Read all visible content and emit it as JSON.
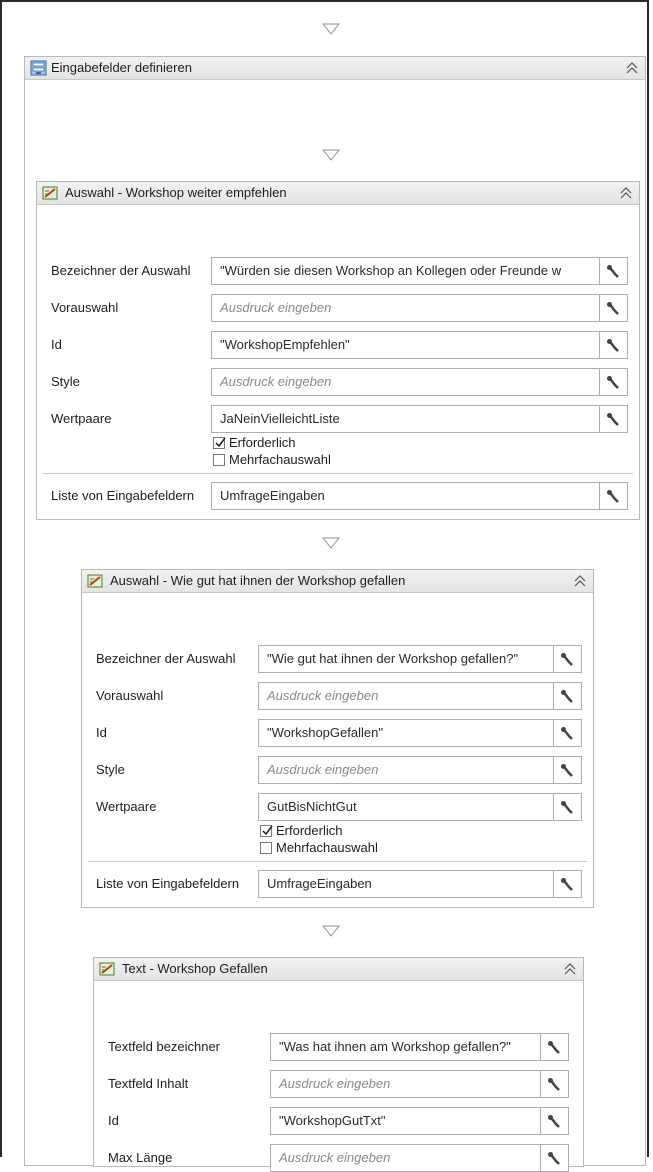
{
  "outer": {
    "title": "Eingabefelder definieren"
  },
  "panels": [
    {
      "title": "Auswahl - Workshop weiter empfehlen",
      "fields": [
        {
          "label": "Bezeichner der Auswahl",
          "value": "\"Würden sie diesen Workshop an Kollegen oder Freunde w",
          "placeholder": ""
        },
        {
          "label": "Vorauswahl",
          "value": "",
          "placeholder": "Ausdruck eingeben"
        },
        {
          "label": "Id",
          "value": "\"WorkshopEmpfehlen\"",
          "placeholder": ""
        },
        {
          "label": "Style",
          "value": "",
          "placeholder": "Ausdruck eingeben"
        },
        {
          "label": "Wertpaare",
          "value": "JaNeinVielleichtListe",
          "placeholder": ""
        }
      ],
      "checkboxes": [
        {
          "label": "Erforderlich",
          "checked": true
        },
        {
          "label": "Mehrfachauswahl",
          "checked": false
        }
      ],
      "list_field": {
        "label": "Liste von Eingabefeldern",
        "value": "UmfrageEingaben"
      }
    },
    {
      "title": "Auswahl - Wie gut hat ihnen der Workshop gefallen",
      "fields": [
        {
          "label": "Bezeichner der Auswahl",
          "value": "\"Wie gut hat ihnen der Workshop gefallen?\"",
          "placeholder": ""
        },
        {
          "label": "Vorauswahl",
          "value": "",
          "placeholder": "Ausdruck eingeben"
        },
        {
          "label": "Id",
          "value": "\"WorkshopGefallen\"",
          "placeholder": ""
        },
        {
          "label": "Style",
          "value": "",
          "placeholder": "Ausdruck eingeben"
        },
        {
          "label": "Wertpaare",
          "value": "GutBisNichtGut",
          "placeholder": ""
        }
      ],
      "checkboxes": [
        {
          "label": "Erforderlich",
          "checked": true
        },
        {
          "label": "Mehrfachauswahl",
          "checked": false
        }
      ],
      "list_field": {
        "label": "Liste von Eingabefeldern",
        "value": "UmfrageEingaben"
      }
    },
    {
      "title": "Text - Workshop Gefallen",
      "fields": [
        {
          "label": "Textfeld bezeichner",
          "value": "\"Was hat ihnen am Workshop gefallen?\"",
          "placeholder": ""
        },
        {
          "label": "Textfeld Inhalt",
          "value": "",
          "placeholder": "Ausdruck eingeben"
        },
        {
          "label": "Id",
          "value": "\"WorkshopGutTxt\"",
          "placeholder": ""
        },
        {
          "label": "Max Länge",
          "value": "",
          "placeholder": "Ausdruck eingeben"
        }
      ]
    }
  ],
  "icons": {
    "flow_arrow": "down-triangle-outline-icon",
    "collapse": "double-chevron-up-icon",
    "expression_editor": "wrench-icon",
    "outer_activity": "form-activity-icon",
    "inner_activity": "choice-activity-icon"
  },
  "colors": {
    "header_bg": "#e8e8e8",
    "border": "#b9b9b9",
    "placeholder": "#8a8a8a",
    "check": "#1e1e1e"
  }
}
